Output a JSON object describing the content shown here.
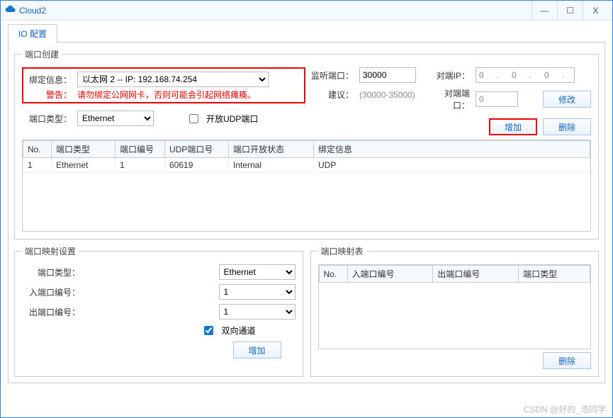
{
  "window": {
    "title": "Cloud2"
  },
  "tab": {
    "label": "IO 配置"
  },
  "port_create": {
    "legend": "端口创建",
    "bind_label": "绑定信息：",
    "bind_value": "以太网 2 -- IP: 192.168.74.254",
    "warn_label": "警告：",
    "warn_text": "请勿绑定公网网卡，否则可能会引起网络瘫痪。",
    "port_type_label": "端口类型：",
    "port_type_value": "Ethernet",
    "open_udp_label": "开放UDP端口",
    "listen_label": "监听端口：",
    "listen_value": "30000",
    "hint_label": "建议：",
    "hint_text": "(30000-35000)",
    "peer_ip_label": "对端IP：",
    "peer_ip_value": "0   .   0   .   0   .   0",
    "peer_port_label": "对端端口：",
    "peer_port_value": "0",
    "modify": "修改",
    "add": "增加",
    "delete": "删除",
    "table": {
      "headers": {
        "no": "No.",
        "type": "端口类型",
        "id": "端口编号",
        "udp": "UDP端口号",
        "status": "端口开放状态",
        "bind": "绑定信息"
      },
      "rows": [
        {
          "no": "1",
          "type": "Ethernet",
          "id": "1",
          "udp": "60619",
          "status": "Internal",
          "bind": "UDP"
        }
      ]
    }
  },
  "map_set": {
    "legend": "端口映射设置",
    "port_type_label": "端口类型：",
    "port_type_value": "Ethernet",
    "in_label": "入端口编号：",
    "in_value": "1",
    "out_label": "出端口编号：",
    "out_value": "1",
    "bi_label": "双向通道",
    "add": "增加"
  },
  "map_tbl": {
    "legend": "端口映射表",
    "headers": {
      "no": "No.",
      "in": "入端口编号",
      "out": "出端口编号",
      "type": "端口类型"
    },
    "delete": "删除"
  },
  "watermark": "CSDN @好的_浩同学"
}
